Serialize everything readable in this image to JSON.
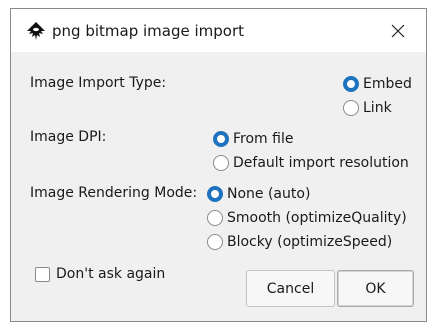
{
  "window": {
    "title": "png bitmap image import",
    "app_icon": "inkscape-icon",
    "close_icon": "close-icon"
  },
  "import_type": {
    "label": "Image Import Type:",
    "options": [
      {
        "label": "Embed",
        "checked": true
      },
      {
        "label": "Link",
        "checked": false
      }
    ]
  },
  "dpi": {
    "label": "Image DPI:",
    "options": [
      {
        "label": "From file",
        "checked": true
      },
      {
        "label": "Default import resolution",
        "checked": false
      }
    ]
  },
  "rendering": {
    "label": "Image Rendering Mode:",
    "options": [
      {
        "label": "None (auto)",
        "checked": true
      },
      {
        "label": "Smooth (optimizeQuality)",
        "checked": false
      },
      {
        "label": "Blocky (optimizeSpeed)",
        "checked": false
      }
    ]
  },
  "dont_ask": {
    "label": "Don't ask again",
    "checked": false
  },
  "buttons": {
    "cancel": "Cancel",
    "ok": "OK"
  },
  "colors": {
    "accent": "#1e73be",
    "client_bg": "#f0f0f0"
  }
}
